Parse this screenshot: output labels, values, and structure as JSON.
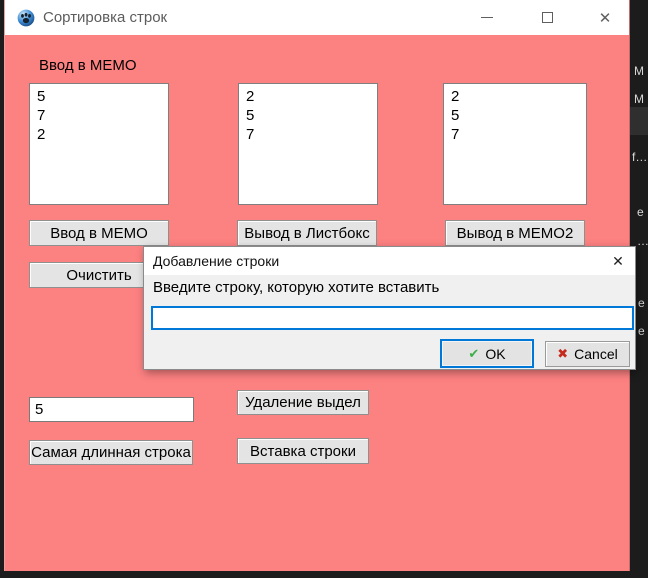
{
  "window": {
    "title": "Сортировка строк",
    "close_glyph": "✕"
  },
  "main": {
    "memo_label": "Ввод в MEMO",
    "memo1_lines": "5\n7\n2",
    "memo2_lines": "2\n5\n7",
    "memo3_lines": "2\n5\n7",
    "buttons": {
      "input_memo": "Ввод в MEMO",
      "output_listbox": "Вывод в Листбокс",
      "output_memo2": "Вывод в MEMO2",
      "clear": "Очистить",
      "longest_line": "Самая длинная строка",
      "delete_selected": "Удаление выдел",
      "insert_line": "Вставка строки"
    },
    "length_value": "5"
  },
  "dialog": {
    "title": "Добавление строки",
    "prompt": "Введите строку, которую хотите вставить",
    "input_value": "",
    "ok_label": "OK",
    "cancel_label": "Cancel",
    "ok_glyph": "✔",
    "cancel_glyph": "✖",
    "close_glyph": "✕"
  },
  "colors": {
    "form_background": "#fc8181",
    "focus_border": "#0078d7",
    "ok_green": "#3daf46",
    "cancel_red": "#c42b1c"
  },
  "desktop": {
    "fragments": {
      "f0": "М",
      "f1": "М",
      "f2": "f…",
      "f3": "e",
      "f4": "…",
      "f5": "e",
      "f6": "e"
    }
  }
}
